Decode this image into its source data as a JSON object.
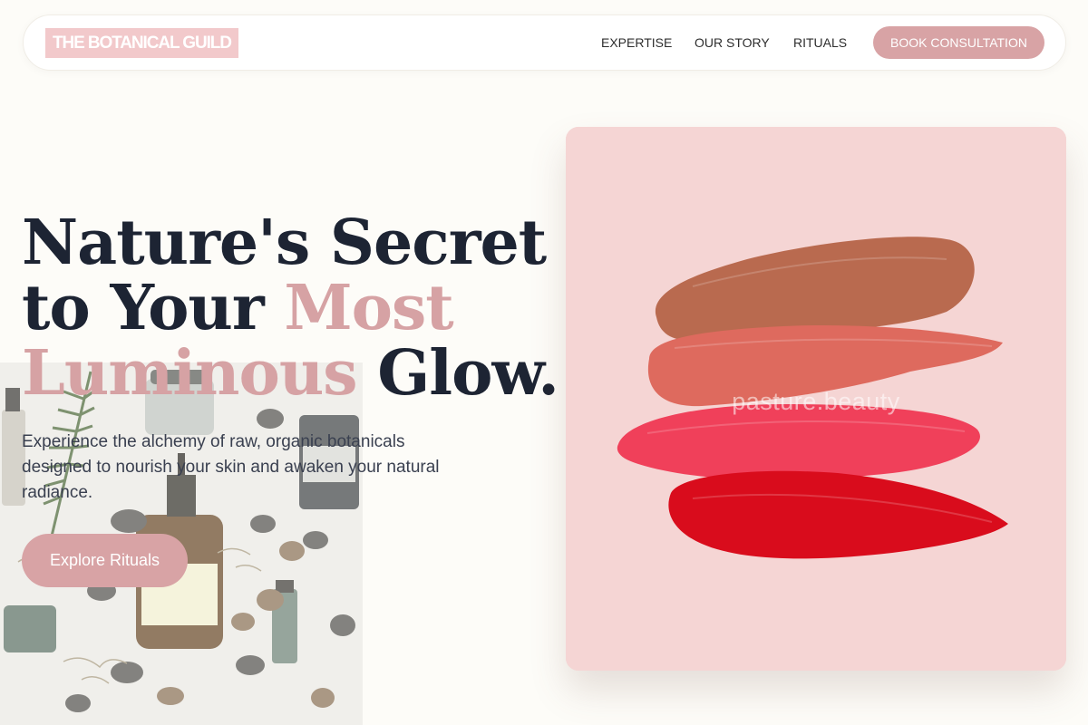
{
  "brand": {
    "name": "THE BOTANICAL GUILD",
    "accent": "#d8a3a5",
    "logo_bg": "#f2c9cb"
  },
  "nav": {
    "links": [
      "EXPERTISE",
      "OUR STORY",
      "RITUALS"
    ],
    "cta_label": "BOOK CONSULTATION"
  },
  "hero": {
    "headline_part1": "Nature's Secret",
    "headline_part2": "to Your ",
    "headline_accent": "Most Luminous",
    "headline_part3": " Glow.",
    "subtext": "Experience the alchemy of raw, organic botanicals designed to nourish your skin and awaken your natural radiance.",
    "cta_label": "Explore Rituals",
    "image_watermark": "pasture.beauty",
    "heading_color": "#1d2433"
  },
  "icons": {
    "hero_image": "lipstick-swatches-image",
    "product_image": "skincare-products-image"
  }
}
